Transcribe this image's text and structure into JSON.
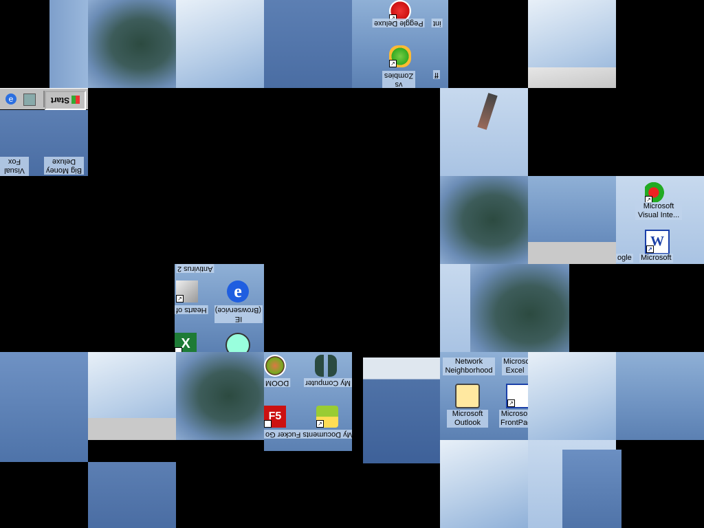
{
  "taskbar": {
    "start_label": "Start"
  },
  "icons": {
    "peggle": "Peggle Deluxe",
    "pvz": "Plants vs Zombies",
    "big_money": "Big Money Deluxe",
    "ms_visual_fox": "Microso Visual Fox",
    "antivirus": "Antivirus 2",
    "hearts": "Hearts of",
    "ie": "IE (Browservice)",
    "doom": "DOOM",
    "my_computer": "My Computer",
    "my_documents": "My Documents Fucker Go",
    "network": "Network Neighborhood",
    "excel": "Microso Excel",
    "outlook": "Microsoft Outlook",
    "frontpage": "Microso FrontPag",
    "ms_visual_inter": "Microsoft Visual Inte...",
    "word": "Microsoft",
    "google": "ogle",
    "frag_int": "int",
    "frag_ff": "ff"
  }
}
